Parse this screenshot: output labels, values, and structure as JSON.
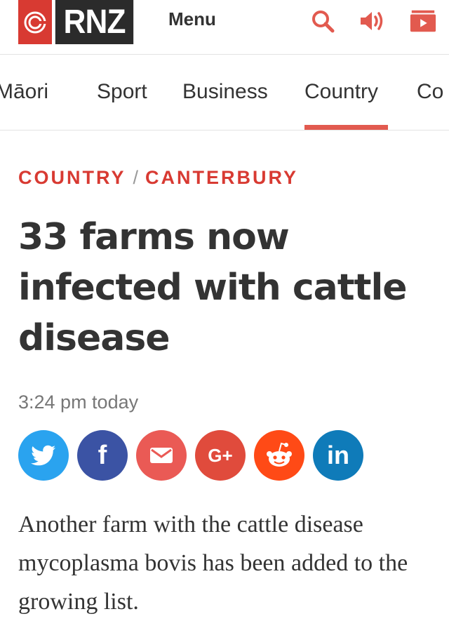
{
  "header": {
    "logo_text": "RNZ",
    "menu_label": "Menu",
    "icons": [
      "search-icon",
      "audio-icon",
      "video-icon"
    ],
    "brand_color": "#d83a32"
  },
  "nav": {
    "items": [
      "Māori",
      "Sport",
      "Business",
      "Country",
      "Co"
    ],
    "active": "Country",
    "accent": "#e25a4f"
  },
  "article": {
    "kicker_section": "COUNTRY",
    "kicker_separator": "/",
    "kicker_region": "CANTERBURY",
    "headline": "33 farms now infected with cattle disease",
    "timestamp": "3:24 pm today",
    "body": "Another farm with the cattle disease mycoplasma bovis has been added to the growing list."
  },
  "share": {
    "buttons": [
      {
        "name": "twitter",
        "color": "#2aa3ef"
      },
      {
        "name": "facebook",
        "color": "#3b53a4"
      },
      {
        "name": "email",
        "color": "#ea5a55"
      },
      {
        "name": "google-plus",
        "color": "#e04b3c"
      },
      {
        "name": "reddit",
        "color": "#ff4a16"
      },
      {
        "name": "linkedin",
        "color": "#0f7bb9"
      }
    ],
    "gplus_label": "G+",
    "facebook_label": "f",
    "linkedin_label": "in"
  }
}
